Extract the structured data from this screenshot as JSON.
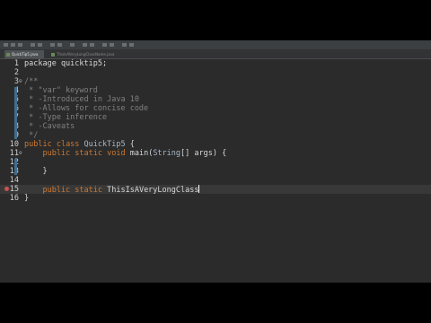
{
  "tabs": [
    {
      "label": "QuickTip5.java",
      "active": true
    },
    {
      "label": "ThisIsAVeryLongClassName.java",
      "active": false
    }
  ],
  "editor": {
    "lines": [
      {
        "num": "1",
        "tokens": [
          {
            "t": "package quicktip5;",
            "c": "plain"
          }
        ]
      },
      {
        "num": "2",
        "tokens": []
      },
      {
        "num": "3",
        "marker": "⊖",
        "tokens": [
          {
            "t": "/**",
            "c": "cm"
          }
        ]
      },
      {
        "num": "4",
        "tokens": [
          {
            "t": " * \"var\" keyword",
            "c": "cm"
          }
        ]
      },
      {
        "num": "5",
        "tokens": [
          {
            "t": " * -Introduced in Java 10",
            "c": "cm"
          }
        ]
      },
      {
        "num": "6",
        "tokens": [
          {
            "t": " * -Allows for concise code",
            "c": "cm"
          }
        ]
      },
      {
        "num": "7",
        "tokens": [
          {
            "t": " * -Type inference",
            "c": "cm"
          }
        ]
      },
      {
        "num": "8",
        "tokens": [
          {
            "t": " * -Caveats",
            "c": "cm"
          }
        ]
      },
      {
        "num": "9",
        "tokens": [
          {
            "t": " */",
            "c": "cm"
          }
        ]
      },
      {
        "num": "10",
        "tokens": [
          {
            "t": "public ",
            "c": "kw"
          },
          {
            "t": "class ",
            "c": "kw"
          },
          {
            "t": "QuickTip5",
            "c": "cls"
          },
          {
            "t": " {",
            "c": "plain"
          }
        ]
      },
      {
        "num": "11",
        "marker": "⊖",
        "tokens": [
          {
            "t": "    public ",
            "c": "kw"
          },
          {
            "t": "static ",
            "c": "kw"
          },
          {
            "t": "void ",
            "c": "kw"
          },
          {
            "t": "main(",
            "c": "plain"
          },
          {
            "t": "String",
            "c": "cls"
          },
          {
            "t": "[] args) {",
            "c": "plain"
          }
        ]
      },
      {
        "num": "12",
        "tokens": []
      },
      {
        "num": "13",
        "tokens": [
          {
            "t": "    }",
            "c": "plain"
          }
        ]
      },
      {
        "num": "14",
        "tokens": []
      },
      {
        "num": "15",
        "error": true,
        "current": true,
        "caret": true,
        "tokens": [
          {
            "t": "    public ",
            "c": "kw"
          },
          {
            "t": "static ",
            "c": "kw"
          },
          {
            "t": "ThisIsAVeryLongClass",
            "c": "plain"
          }
        ]
      },
      {
        "num": "16",
        "tokens": [
          {
            "t": "}",
            "c": "plain"
          }
        ]
      }
    ]
  },
  "colors": {
    "background": "#2b2b2b",
    "keyword": "#cc7832",
    "comment": "#808080",
    "error": "#c75450"
  }
}
